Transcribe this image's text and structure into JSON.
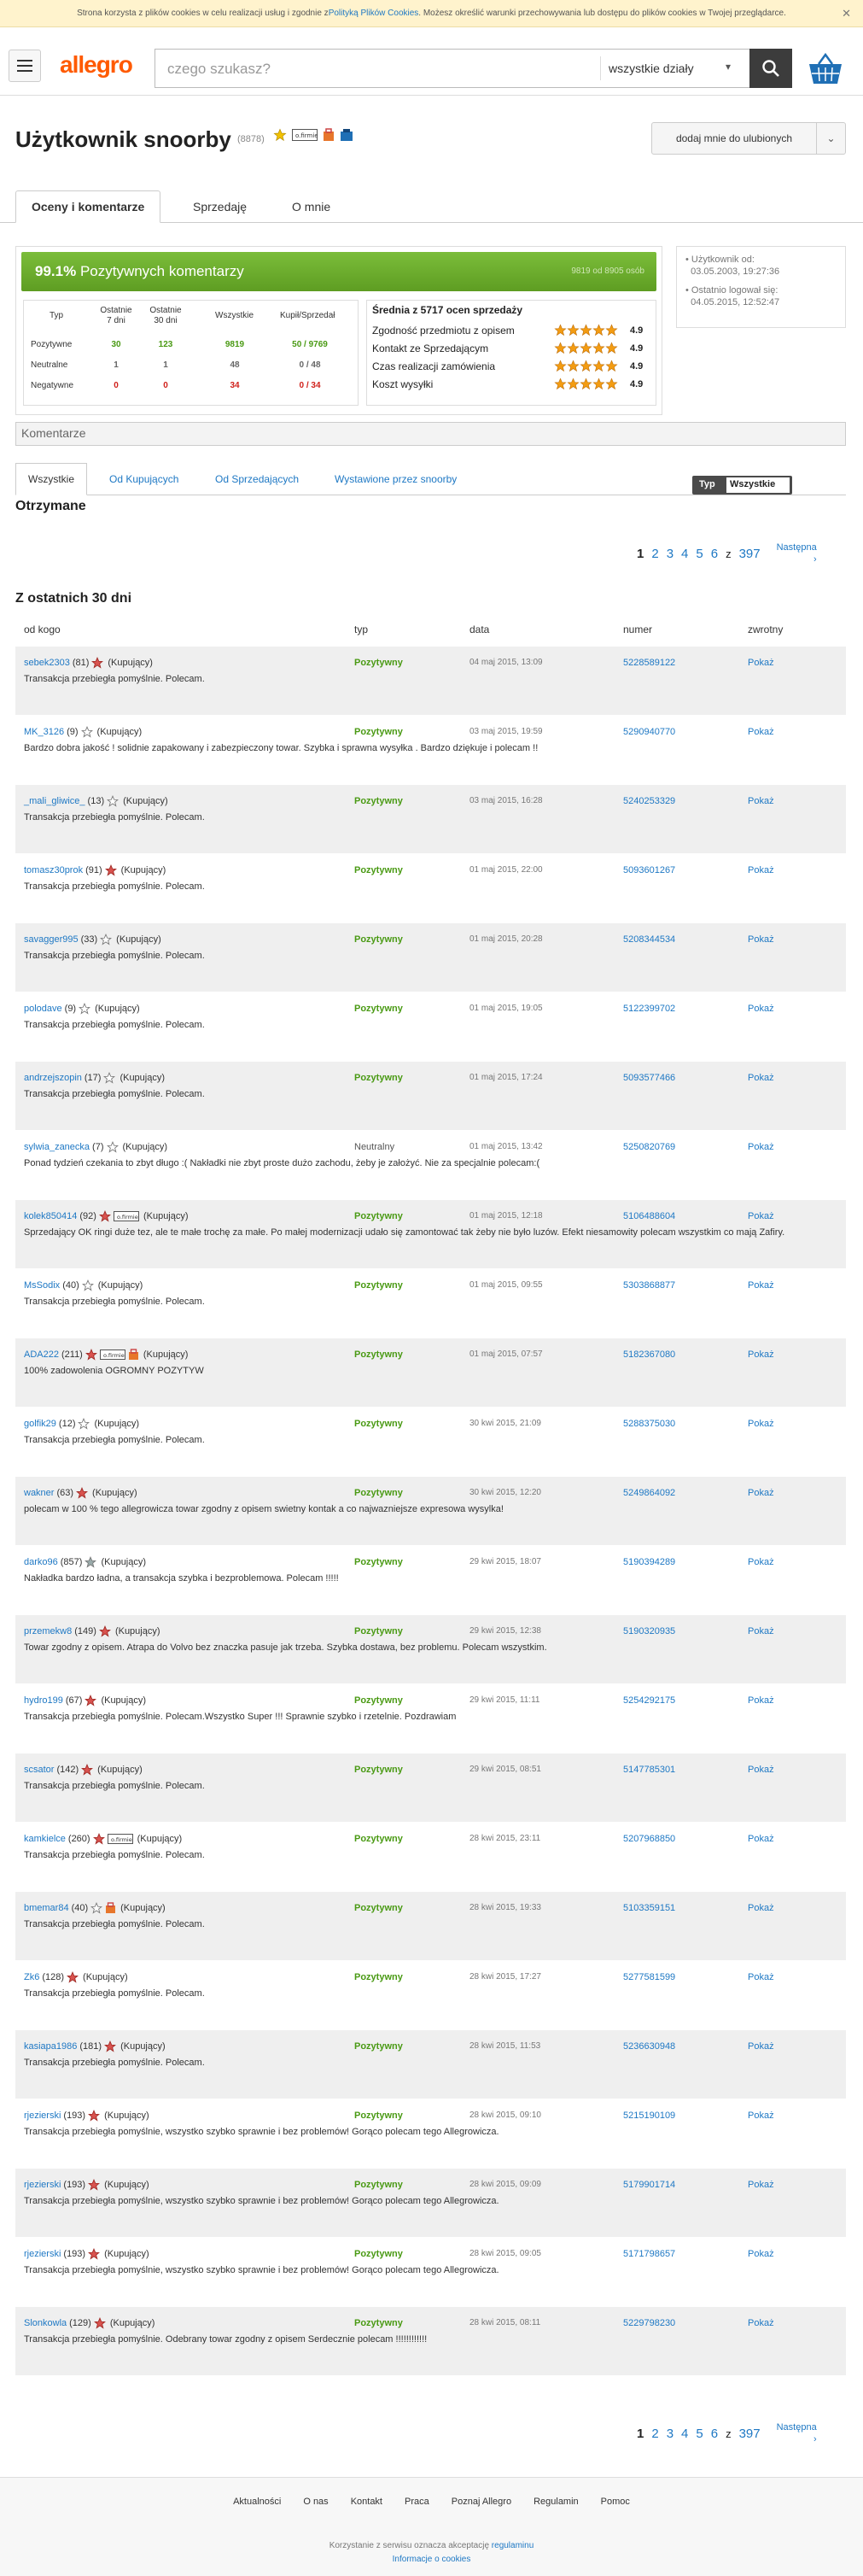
{
  "cookie": {
    "text_a": "Strona korzysta z plików cookies w celu realizacji usług i zgodnie z ",
    "link": "Polityką Plików Cookies",
    "text_b": ". Możesz określić warunki przechowywania lub dostępu do plików cookies w Twojej przeglądarce.",
    "close": "✕"
  },
  "header": {
    "logo": "allegro",
    "search_placeholder": "czego szukasz?",
    "category": "wszystkie działy"
  },
  "profile": {
    "title": "Użytkownik snoorby",
    "count": "(8878)",
    "fav_button": "dodaj mnie do ulubionych"
  },
  "tabs": [
    "Oceny i komentarze",
    "Sprzedaję",
    "O mnie"
  ],
  "summary": {
    "pct": "99.1%",
    "label": "Pozytywnych komentarzy",
    "right": "9819 od 8905 osób"
  },
  "stats": {
    "headers": [
      "Typ",
      "Ostatnie\n7 dni",
      "Ostatnie\n30 dni",
      "Wszystkie",
      "Kupił/Sprzedał"
    ],
    "rows": [
      {
        "label": "Pozytywne",
        "v": [
          "30",
          "123",
          "9819",
          "50 / 9769"
        ],
        "cls": "g"
      },
      {
        "label": "Neutralne",
        "v": [
          "1",
          "1",
          "48",
          "0 / 48"
        ],
        "cls": "gr"
      },
      {
        "label": "Negatywne",
        "v": [
          "0",
          "0",
          "34",
          "0 / 34"
        ],
        "cls": "rd"
      }
    ]
  },
  "avg": {
    "title": "Średnia z 5717 ocen sprzedaży",
    "rows": [
      {
        "label": "Zgodność przedmiotu z opisem",
        "score": "4.9"
      },
      {
        "label": "Kontakt ze Sprzedającym",
        "score": "4.9"
      },
      {
        "label": "Czas realizacji zamówienia",
        "score": "4.9"
      },
      {
        "label": "Koszt wysyłki",
        "score": "4.9"
      }
    ]
  },
  "side": {
    "since_label": "Użytkownik od:",
    "since": "03.05.2003, 19:27:36",
    "last_label": "Ostatnio logował się:",
    "last": "04.05.2015, 12:52:47"
  },
  "komentarze": "Komentarze",
  "filters": {
    "all": "Wszystkie",
    "buyers": "Od Kupujących",
    "sellers": "Od Sprzedających",
    "issued": "Wystawione przez snoorby",
    "type_label": "Typ",
    "type_value": "Wszystkie"
  },
  "received": "Otrzymane",
  "pager": {
    "pages": [
      "1",
      "2",
      "3",
      "4",
      "5",
      "6"
    ],
    "z": "z",
    "total": "397",
    "next": "Następna"
  },
  "last30": "Z ostatnich 30 dni",
  "columns": {
    "from": "od kogo",
    "type": "typ",
    "date": "data",
    "number": "numer",
    "return": "zwrotny"
  },
  "rows": [
    {
      "user": "sebek2303",
      "count": "(81)",
      "role": "(Kupujący)",
      "star": "red",
      "type": "Pozytywny",
      "date": "04 maj 2015, 13:09",
      "num": "5228589122",
      "show": "Pokaż",
      "comment": "Transakcja przebiegła pomyślnie. Polecam."
    },
    {
      "user": "MK_3126",
      "count": "(9)",
      "role": "(Kupujący)",
      "star": "empty",
      "type": "Pozytywny",
      "date": "03 maj 2015, 19:59",
      "num": "5290940770",
      "show": "Pokaż",
      "comment": "Bardzo dobra jakość ! solidnie zapakowany i zabezpieczony towar. Szybka i sprawna wysyłka . Bardzo dziękuje i polecam !!"
    },
    {
      "user": "_mali_gliwice_",
      "count": "(13)",
      "role": "(Kupujący)",
      "star": "empty",
      "type": "Pozytywny",
      "date": "03 maj 2015, 16:28",
      "num": "5240253329",
      "show": "Pokaż",
      "comment": "Transakcja przebiegła pomyślnie. Polecam."
    },
    {
      "user": "tomasz30prok",
      "count": "(91)",
      "role": "(Kupujący)",
      "star": "red",
      "type": "Pozytywny",
      "date": "01 maj 2015, 22:00",
      "num": "5093601267",
      "show": "Pokaż",
      "comment": "Transakcja przebiegła pomyślnie. Polecam."
    },
    {
      "user": "savagger995",
      "count": "(33)",
      "role": "(Kupujący)",
      "star": "empty",
      "type": "Pozytywny",
      "date": "01 maj 2015, 20:28",
      "num": "5208344534",
      "show": "Pokaż",
      "comment": "Transakcja przebiegła pomyślnie. Polecam."
    },
    {
      "user": "polodave",
      "count": "(9)",
      "role": "(Kupujący)",
      "star": "empty",
      "type": "Pozytywny",
      "date": "01 maj 2015, 19:05",
      "num": "5122399702",
      "show": "Pokaż",
      "comment": "Transakcja przebiegła pomyślnie. Polecam."
    },
    {
      "user": "andrzejszopin",
      "count": "(17)",
      "role": "(Kupujący)",
      "star": "empty",
      "type": "Pozytywny",
      "date": "01 maj 2015, 17:24",
      "num": "5093577466",
      "show": "Pokaż",
      "comment": "Transakcja przebiegła pomyślnie. Polecam."
    },
    {
      "user": "sylwia_zanecka",
      "count": "(7)",
      "role": "(Kupujący)",
      "star": "empty",
      "type": "Neutralny",
      "date": "01 maj 2015, 13:42",
      "num": "5250820769",
      "show": "Pokaż",
      "comment": "Ponad tydzień czekania to zbyt długo :( Nakładki nie zbyt proste dużo zachodu, żeby je założyć. Nie za specjalnie polecam:("
    },
    {
      "user": "kolek850414",
      "count": "(92)",
      "role": "(Kupujący)",
      "star": "red",
      "firm": true,
      "type": "Pozytywny",
      "date": "01 maj 2015, 12:18",
      "num": "5106488604",
      "show": "Pokaż",
      "comment": "Sprzedający OK ringi duże tez, ale te małe trochę za małe. Po małej modernizacji udało się zamontować tak żeby nie było luzów. Efekt niesamowity polecam wszystkim co mają Zafiry."
    },
    {
      "user": "MsSodix",
      "count": "(40)",
      "role": "(Kupujący)",
      "star": "empty",
      "type": "Pozytywny",
      "date": "01 maj 2015, 09:55",
      "num": "5303868877",
      "show": "Pokaż",
      "comment": "Transakcja przebiegła pomyślnie. Polecam."
    },
    {
      "user": "ADA222",
      "count": "(211)",
      "role": "(Kupujący)",
      "star": "red",
      "firm": true,
      "bag": true,
      "type": "Pozytywny",
      "date": "01 maj 2015, 07:57",
      "num": "5182367080",
      "show": "Pokaż",
      "comment": "100% zadowolenia OGROMNY POZYTYW"
    },
    {
      "user": "golfik29",
      "count": "(12)",
      "role": "(Kupujący)",
      "star": "empty",
      "type": "Pozytywny",
      "date": "30 kwi 2015, 21:09",
      "num": "5288375030",
      "show": "Pokaż",
      "comment": "Transakcja przebiegła pomyślnie. Polecam."
    },
    {
      "user": "wakner",
      "count": "(63)",
      "role": "(Kupujący)",
      "star": "red",
      "type": "Pozytywny",
      "date": "30 kwi 2015, 12:20",
      "num": "5249864092",
      "show": "Pokaż",
      "comment": "polecam w 100 % tego allegrowicza towar zgodny z opisem swietny kontak a co najwazniejsze expresowa wysylka!"
    },
    {
      "user": "darko96",
      "count": "(857)",
      "role": "(Kupujący)",
      "star": "grey",
      "type": "Pozytywny",
      "date": "29 kwi 2015, 18:07",
      "num": "5190394289",
      "show": "Pokaż",
      "comment": "Nakładka bardzo ładna, a transakcja szybka i bezproblemowa. Polecam !!!!!"
    },
    {
      "user": "przemekw8",
      "count": "(149)",
      "role": "(Kupujący)",
      "star": "red",
      "type": "Pozytywny",
      "date": "29 kwi 2015, 12:38",
      "num": "5190320935",
      "show": "Pokaż",
      "comment": "Towar zgodny z opisem. Atrapa do Volvo bez znaczka pasuje jak trzeba. Szybka dostawa, bez problemu. Polecam wszystkim."
    },
    {
      "user": "hydro199",
      "count": "(67)",
      "role": "(Kupujący)",
      "star": "red",
      "type": "Pozytywny",
      "date": "29 kwi 2015, 11:11",
      "num": "5254292175",
      "show": "Pokaż",
      "comment": "Transakcja przebiegła pomyślnie. Polecam.Wszystko Super !!! Sprawnie szybko i rzetelnie. Pozdrawiam"
    },
    {
      "user": "scsator",
      "count": "(142)",
      "role": "(Kupujący)",
      "star": "red",
      "type": "Pozytywny",
      "date": "29 kwi 2015, 08:51",
      "num": "5147785301",
      "show": "Pokaż",
      "comment": "Transakcja przebiegła pomyślnie. Polecam."
    },
    {
      "user": "kamkielce",
      "count": "(260)",
      "role": "(Kupujący)",
      "star": "red",
      "firm": true,
      "type": "Pozytywny",
      "date": "28 kwi 2015, 23:11",
      "num": "5207968850",
      "show": "Pokaż",
      "comment": "Transakcja przebiegła pomyślnie. Polecam."
    },
    {
      "user": "bmemar84",
      "count": "(40)",
      "role": "(Kupujący)",
      "star": "empty",
      "bag": true,
      "type": "Pozytywny",
      "date": "28 kwi 2015, 19:33",
      "num": "5103359151",
      "show": "Pokaż",
      "comment": "Transakcja przebiegła pomyślnie. Polecam."
    },
    {
      "user": "Zk6",
      "count": "(128)",
      "role": "(Kupujący)",
      "star": "red",
      "type": "Pozytywny",
      "date": "28 kwi 2015, 17:27",
      "num": "5277581599",
      "show": "Pokaż",
      "comment": "Transakcja przebiegła pomyślnie. Polecam."
    },
    {
      "user": "kasiapa1986",
      "count": "(181)",
      "role": "(Kupujący)",
      "star": "red",
      "type": "Pozytywny",
      "date": "28 kwi 2015, 11:53",
      "num": "5236630948",
      "show": "Pokaż",
      "comment": "Transakcja przebiegła pomyślnie. Polecam."
    },
    {
      "user": "rjezierski",
      "count": "(193)",
      "role": "(Kupujący)",
      "star": "red",
      "type": "Pozytywny",
      "date": "28 kwi 2015, 09:10",
      "num": "5215190109",
      "show": "Pokaż",
      "comment": "Transakcja przebiegła pomyślnie, wszystko szybko sprawnie i bez problemów! Gorąco polecam tego Allegrowicza."
    },
    {
      "user": "rjezierski",
      "count": "(193)",
      "role": "(Kupujący)",
      "star": "red",
      "type": "Pozytywny",
      "date": "28 kwi 2015, 09:09",
      "num": "5179901714",
      "show": "Pokaż",
      "comment": "Transakcja przebiegła pomyślnie, wszystko szybko sprawnie i bez problemów! Gorąco polecam tego Allegrowicza."
    },
    {
      "user": "rjezierski",
      "count": "(193)",
      "role": "(Kupujący)",
      "star": "red",
      "type": "Pozytywny",
      "date": "28 kwi 2015, 09:05",
      "num": "5171798657",
      "show": "Pokaż",
      "comment": "Transakcja przebiegła pomyślnie, wszystko szybko sprawnie i bez problemów! Gorąco polecam tego Allegrowicza."
    },
    {
      "user": "Slonkowla",
      "count": "(129)",
      "role": "(Kupujący)",
      "star": "red",
      "type": "Pozytywny",
      "date": "28 kwi 2015, 08:11",
      "num": "5229798230",
      "show": "Pokaż",
      "comment": "Transakcja przebiegła pomyślnie. Odebrany towar zgodny z opisem Serdecznie polecam !!!!!!!!!!!!"
    }
  ],
  "footer": {
    "links": [
      "Aktualności",
      "O nas",
      "Kontakt",
      "Praca",
      "Poznaj Allegro",
      "Regulamin",
      "Pomoc"
    ],
    "copy": "Korzystanie z serwisu oznacza akceptację",
    "copy_link": "regulaminu",
    "cookies_info": "Informacje o cookies"
  },
  "colors": {
    "brand": "#ff5a00",
    "link": "#1e78c4",
    "positive": "#4a9a14",
    "negative": "#d0211b",
    "bar": "#6fae2f"
  }
}
